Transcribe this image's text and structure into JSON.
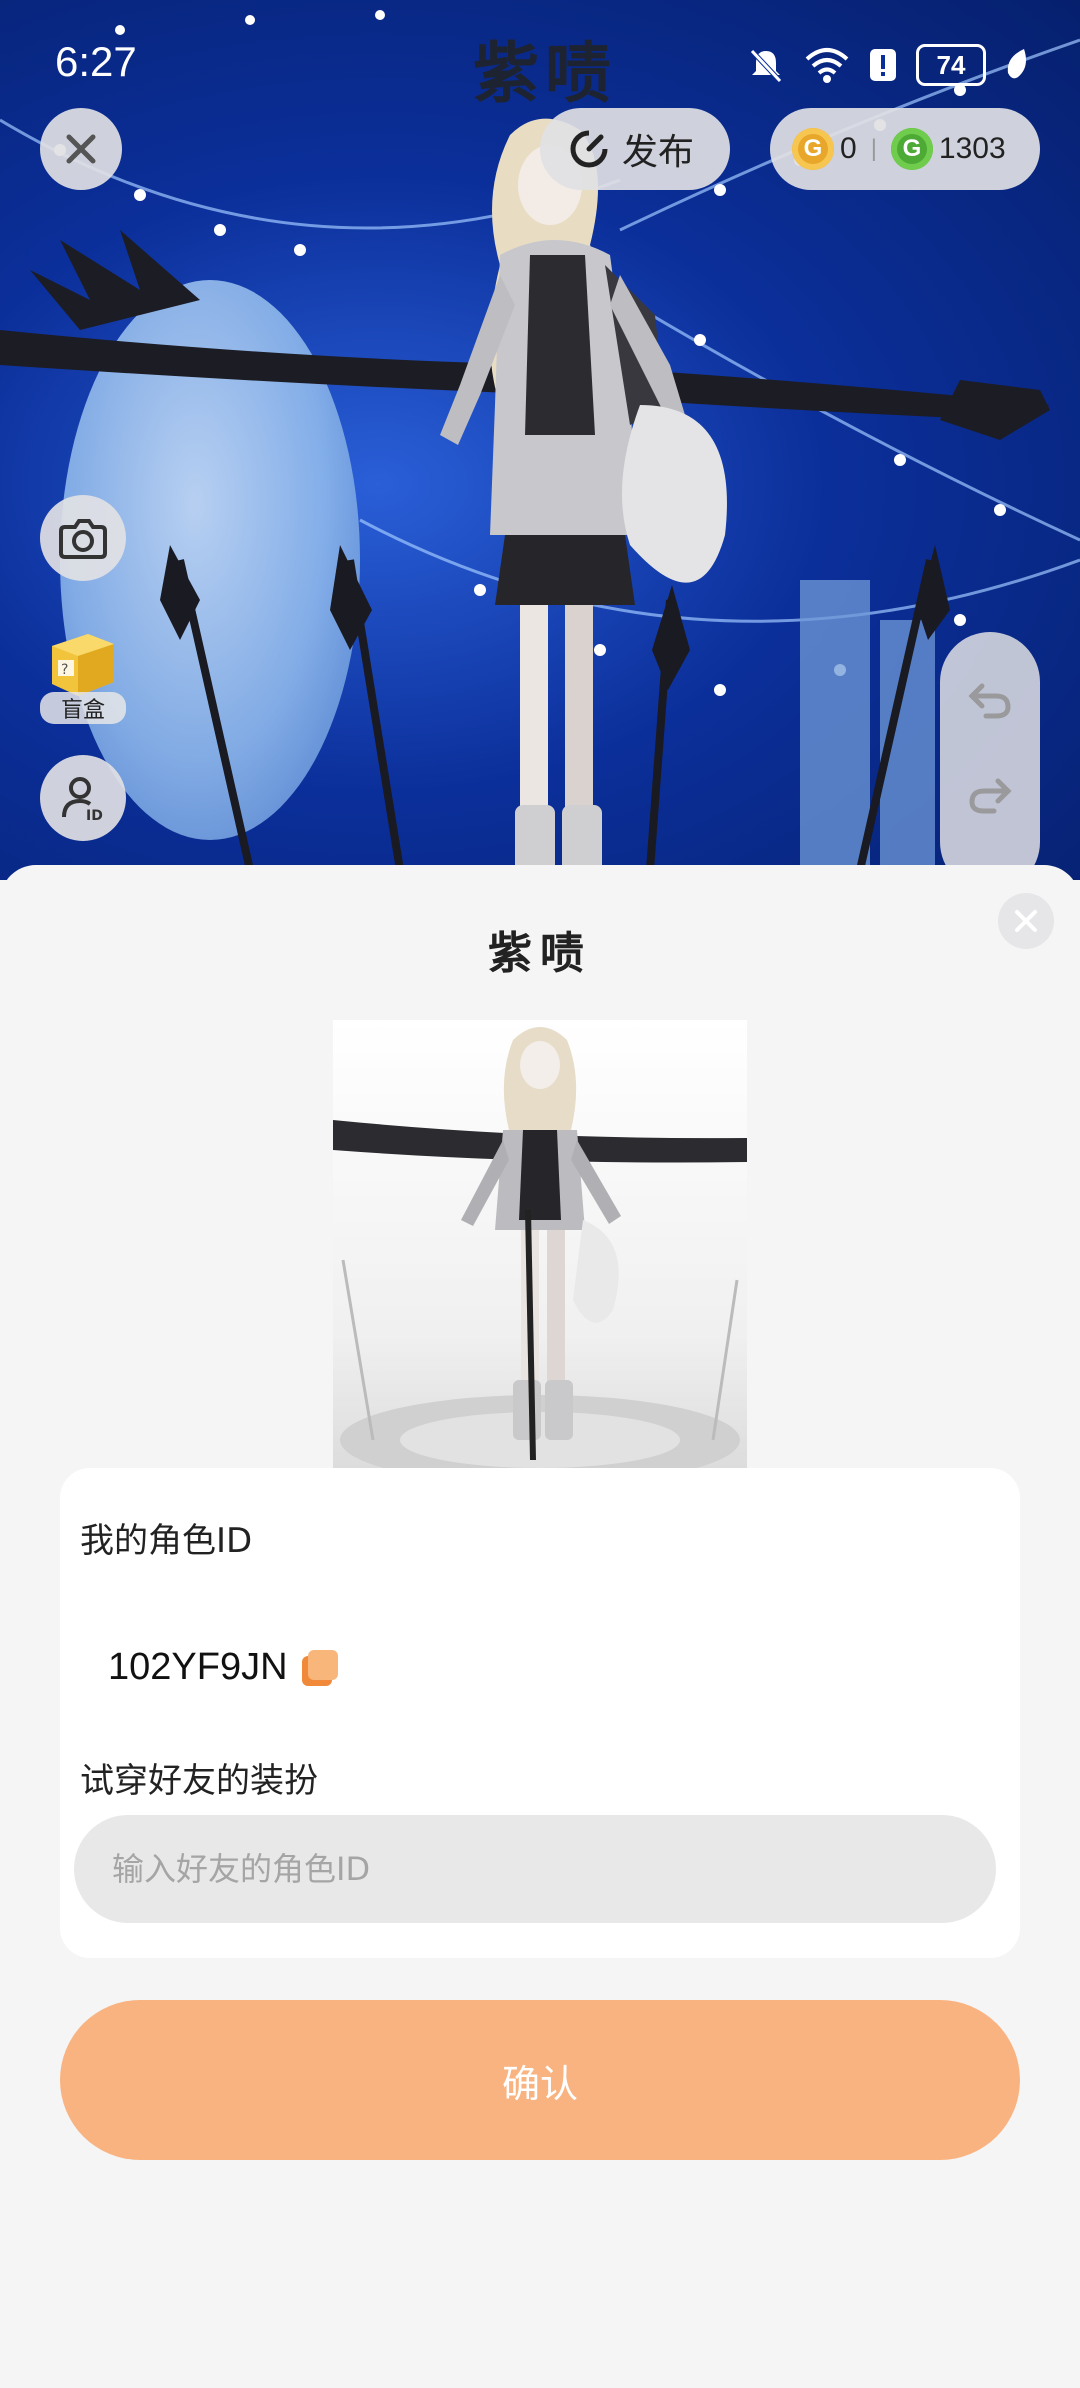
{
  "status_bar": {
    "time": "6:27",
    "battery": "74"
  },
  "header": {
    "character_name": "紫啧",
    "publish_label": "发布",
    "currency": [
      {
        "icon": "gold-coin-icon",
        "value": "0"
      },
      {
        "icon": "green-gem-icon",
        "value": "1303"
      }
    ]
  },
  "side_tools": {
    "blind_box_label": "盲盒"
  },
  "sheet": {
    "preview_name": "紫啧",
    "my_id_label": "我的角色ID",
    "my_id_value": "102YF9JN",
    "try_on_label": "试穿好友的装扮",
    "friend_id_placeholder": "输入好友的角色ID",
    "confirm_label": "确认"
  },
  "colors": {
    "accent": "#f9b381",
    "copy_icon": "#f08a3a",
    "scene_blue": "#0b2f9a"
  }
}
